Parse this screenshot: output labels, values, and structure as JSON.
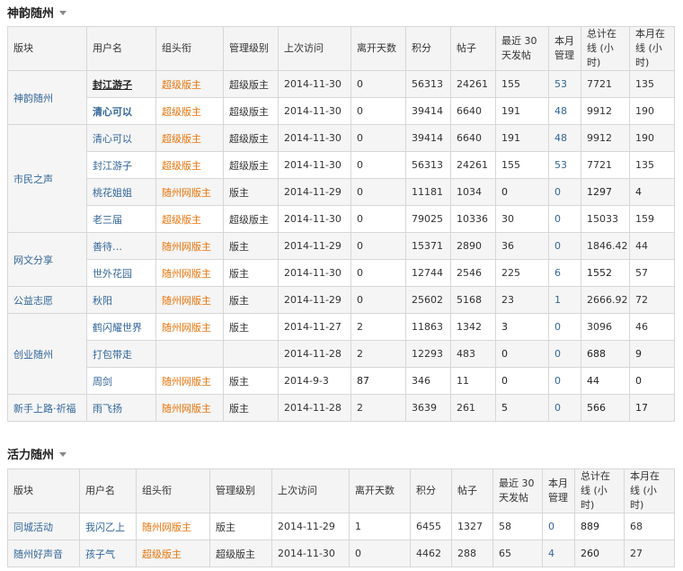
{
  "section1": {
    "title": "神韵随州",
    "headers": [
      "版块",
      "用户名",
      "组头衔",
      "管理级别",
      "上次访问",
      "离开天数",
      "积分",
      "帖子",
      "最近 30 天发帖",
      "本月管理",
      "总计在线 (小时)",
      "本月在线 (小时)"
    ],
    "rows": [
      {
        "block": "神韵随州",
        "user": "封江游子",
        "title": "超级版主",
        "level": "超级版主",
        "visit": "2014-11-30",
        "days": "0",
        "points": "56313",
        "posts": "24261",
        "recent": "155",
        "mgmt": "53",
        "total": "7721",
        "month": "135"
      },
      {
        "user": "清心可以",
        "title": "超级版主",
        "level": "超级版主",
        "visit": "2014-11-30",
        "days": "0",
        "points": "39414",
        "posts": "6640",
        "recent": "191",
        "mgmt": "48",
        "total": "9912",
        "month": "190"
      },
      {
        "block": "市民之声",
        "user": "清心可以",
        "title": "超级版主",
        "level": "超级版主",
        "visit": "2014-11-30",
        "days": "0",
        "points": "39414",
        "posts": "6640",
        "recent": "191",
        "mgmt": "48",
        "total": "9912",
        "month": "190"
      },
      {
        "user": "封江游子",
        "title": "超级版主",
        "level": "超级版主",
        "visit": "2014-11-30",
        "days": "0",
        "points": "56313",
        "posts": "24261",
        "recent": "155",
        "mgmt": "53",
        "total": "7721",
        "month": "135"
      },
      {
        "user": "桃花姐姐",
        "title": "随州网版主",
        "level": "版主",
        "visit": "2014-11-29",
        "days": "0",
        "points": "11181",
        "posts": "1034",
        "recent": "0",
        "mgmt": "0",
        "total": "1297",
        "month": "4"
      },
      {
        "user": "老三届",
        "title": "超级版主",
        "level": "超级版主",
        "visit": "2014-11-30",
        "days": "0",
        "points": "79025",
        "posts": "10336",
        "recent": "30",
        "mgmt": "0",
        "total": "15033",
        "month": "159"
      },
      {
        "block": "网文分享",
        "user": "善待…",
        "title": "随州网版主",
        "level": "版主",
        "visit": "2014-11-29",
        "days": "0",
        "points": "15371",
        "posts": "2890",
        "recent": "36",
        "mgmt": "0",
        "total": "1846.42",
        "month": "44"
      },
      {
        "user": "世外花园",
        "title": "随州网版主",
        "level": "版主",
        "visit": "2014-11-30",
        "days": "0",
        "points": "12744",
        "posts": "2546",
        "recent": "225",
        "mgmt": "6",
        "total": "1552",
        "month": "57"
      },
      {
        "block": "公益志愿",
        "user": "秋阳",
        "title": "随州网版主",
        "level": "版主",
        "visit": "2014-11-29",
        "days": "0",
        "points": "25602",
        "posts": "5168",
        "recent": "23",
        "mgmt": "1",
        "total": "2666.92",
        "month": "72"
      },
      {
        "block": "创业随州",
        "user": "鹤闪耀世界",
        "title": "随州网版主",
        "level": "版主",
        "visit": "2014-11-27",
        "days": "2",
        "points": "11863",
        "posts": "1342",
        "recent": "3",
        "mgmt": "0",
        "total": "3096",
        "month": "46"
      },
      {
        "user": "打包带走",
        "title": "",
        "level": "",
        "visit": "2014-11-28",
        "days": "2",
        "points": "12293",
        "posts": "483",
        "recent": "0",
        "mgmt": "0",
        "total": "688",
        "month": "9"
      },
      {
        "user": "周剑",
        "title": "随州网版主",
        "level": "版主",
        "visit": "2014-9-3",
        "days": "87",
        "points": "346",
        "posts": "11",
        "recent": "0",
        "mgmt": "0",
        "total": "44",
        "month": "0"
      },
      {
        "block": "新手上路·祈福",
        "user": "雨飞扬",
        "title": "随州网版主",
        "level": "版主",
        "visit": "2014-11-28",
        "days": "2",
        "points": "3639",
        "posts": "261",
        "recent": "5",
        "mgmt": "0",
        "total": "566",
        "month": "17"
      }
    ]
  },
  "section2": {
    "title": "活力随州",
    "headers": [
      "版块",
      "用户名",
      "组头衔",
      "管理级别",
      "上次访问",
      "离开天数",
      "积分",
      "帖子",
      "最近 30 天发帖",
      "本月管理",
      "总计在线 (小时)",
      "本月在线 (小时)"
    ],
    "rows": [
      {
        "block": "同城活动",
        "user": "我闪乙上",
        "title": "随州网版主",
        "level": "版主",
        "visit": "2014-11-29",
        "days": "1",
        "points": "6455",
        "posts": "1327",
        "recent": "58",
        "mgmt": "0",
        "total": "889",
        "month": "68"
      },
      {
        "block": "随州好声音",
        "user": "孩子气",
        "title": "超级版主",
        "level": "超级版主",
        "visit": "2014-11-30",
        "days": "0",
        "points": "4462",
        "posts": "288",
        "recent": "65",
        "mgmt": "4",
        "total": "260",
        "month": "27"
      }
    ]
  }
}
